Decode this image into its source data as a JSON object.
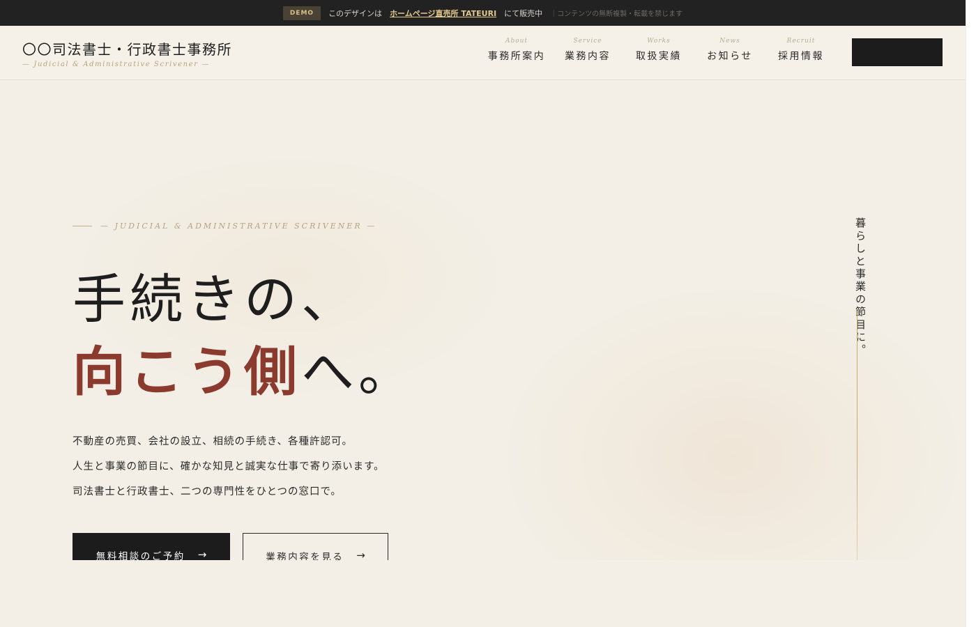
{
  "demo_bar": {
    "badge": "DEMO",
    "text_before": "このデザインは",
    "link": "ホームページ直売所 TATEURI",
    "text_after": "にて販売中",
    "note": "｜コンテンツの無断複製・転載を禁じます"
  },
  "header": {
    "brand_name": "〇〇司法書士・行政書士事務所",
    "brand_sub": "— Judicial & Administrative Scrivener —",
    "nav": [
      {
        "en": "About",
        "ja": "事務所案内"
      },
      {
        "en": "Service",
        "ja": "業務内容"
      },
      {
        "en": "Works",
        "ja": "取扱実績"
      },
      {
        "en": "News",
        "ja": "お知らせ"
      },
      {
        "en": "Recruit",
        "ja": "採用情報"
      }
    ]
  },
  "hero": {
    "eyebrow": "— JUDICIAL & ADMINISTRATIVE SCRIVENER —",
    "headline_line1": "手続きの、",
    "headline_accent": "向こう側",
    "headline_tail": "へ。",
    "lead": [
      "不動産の売買、会社の設立、相続の手続き、各種許認可。",
      "人生と事業の節目に、確かな知見と誠実な仕事で寄り添います。",
      "司法書士と行政書士、二つの専門性をひとつの窓口で。"
    ],
    "primary_button": "無料相談のご予約",
    "secondary_button": "業務内容を見る",
    "arrow": "→",
    "vertical_copy": "暮らしと事業の節目に。"
  },
  "colors": {
    "background": "#f3efe6",
    "ink": "#1c1c1c",
    "accent": "#8b3a2e",
    "gold": "#c8aa72"
  }
}
